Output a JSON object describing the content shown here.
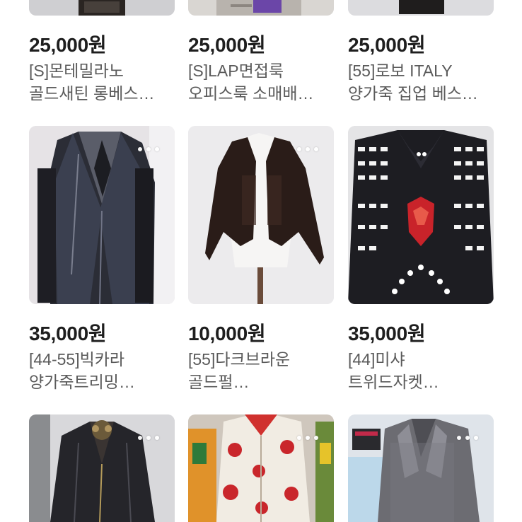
{
  "listings": [
    {
      "price": "25,000원",
      "title_line1": "[S]몬테밀라노",
      "title_line2": "골드새틴 롱베스…"
    },
    {
      "price": "25,000원",
      "title_line1": "[S]LAP면접룩",
      "title_line2": "오피스룩 소매배…"
    },
    {
      "price": "25,000원",
      "title_line1": "[55]로보 ITALY",
      "title_line2": "양가죽 집업 베스…"
    },
    {
      "price": "35,000원",
      "title_line1": "[44-55]빅카라",
      "title_line2": "양가죽트리밍…"
    },
    {
      "price": "10,000원",
      "title_line1": "[55]다크브라운",
      "title_line2": "골드펄…"
    },
    {
      "price": "35,000원",
      "title_line1": "[44]미샤",
      "title_line2": "트위드자켓…"
    },
    {
      "price": "",
      "title_line1": "",
      "title_line2": ""
    },
    {
      "price": "",
      "title_line1": "",
      "title_line2": ""
    },
    {
      "price": "",
      "title_line1": "",
      "title_line2": ""
    }
  ],
  "colors": {
    "price": "#1e1e1e",
    "title": "#5a5a5a",
    "thumb_bg": "#e9e9ec"
  },
  "icons": [
    "more-dots-icon"
  ]
}
